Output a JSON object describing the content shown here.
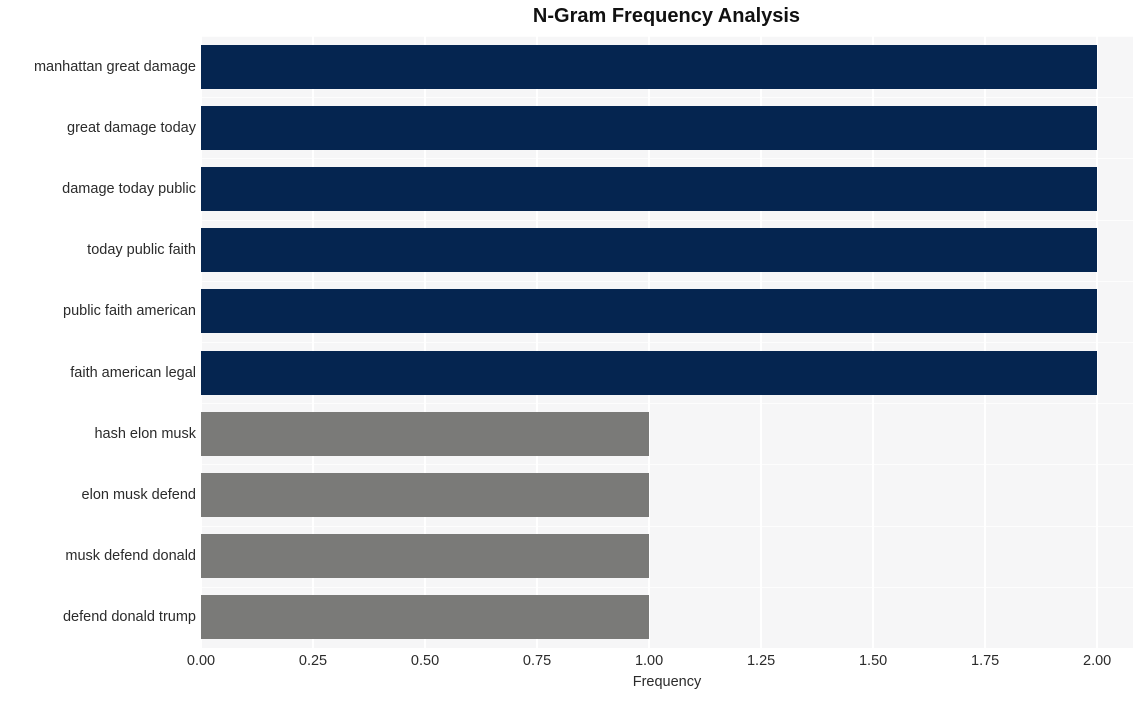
{
  "chart_data": {
    "type": "bar",
    "orientation": "horizontal",
    "title": "N-Gram Frequency Analysis",
    "xlabel": "Frequency",
    "ylabel": "",
    "categories": [
      "manhattan great damage",
      "great damage today",
      "damage today public",
      "today public faith",
      "public faith american",
      "faith american legal",
      "hash elon musk",
      "elon musk defend",
      "musk defend donald",
      "defend donald trump"
    ],
    "values": [
      2,
      2,
      2,
      2,
      2,
      2,
      1,
      1,
      1,
      1
    ],
    "bar_colors": [
      "#052550",
      "#052550",
      "#052550",
      "#052550",
      "#052550",
      "#052550",
      "#7a7a78",
      "#7a7a78",
      "#7a7a78",
      "#7a7a78"
    ],
    "xlim": [
      0,
      2.08
    ],
    "xticks": [
      0,
      0.25,
      0.5,
      0.75,
      1,
      1.25,
      1.5,
      1.75,
      2
    ],
    "xticklabels": [
      "0.00",
      "0.25",
      "0.50",
      "0.75",
      "1.00",
      "1.25",
      "1.50",
      "1.75",
      "2.00"
    ],
    "grid": true,
    "legend": false,
    "plot_background": "#f6f6f7",
    "figure_background": "#ffffff",
    "gridline_color": "#ffffff"
  }
}
